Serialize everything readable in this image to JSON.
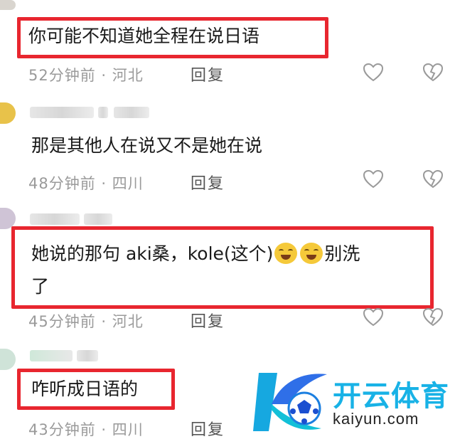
{
  "comments": [
    {
      "text": "你可能不知道她全程在说日语",
      "time": "52分钟前",
      "location": "· 河北",
      "reply": "回复"
    },
    {
      "text": "那是其他人在说又不是她在说",
      "time": "48分钟前",
      "location": "· 四川",
      "reply": "回复"
    },
    {
      "text_line1": "她说的那句  aki桑，kole(这个)",
      "text_tail": "别洗",
      "text_line2": "了",
      "emoji": [
        "laughing-crying-emoji",
        "laughing-crying-emoji"
      ],
      "time": "45分钟前",
      "location": "· 河北",
      "reply": "回复"
    },
    {
      "text": "咋听成日语的",
      "time": "43分钟前",
      "location": "· 四川",
      "reply": "回复"
    }
  ],
  "watermark": {
    "title": "开云体育",
    "url": "kaiyun.com"
  },
  "colors": {
    "highlight_border": "#e8262f",
    "brand": "#18b2e6",
    "meta_text": "#9a9a9a"
  },
  "icons": [
    "like-heart-icon",
    "dislike-broken-heart-icon"
  ]
}
